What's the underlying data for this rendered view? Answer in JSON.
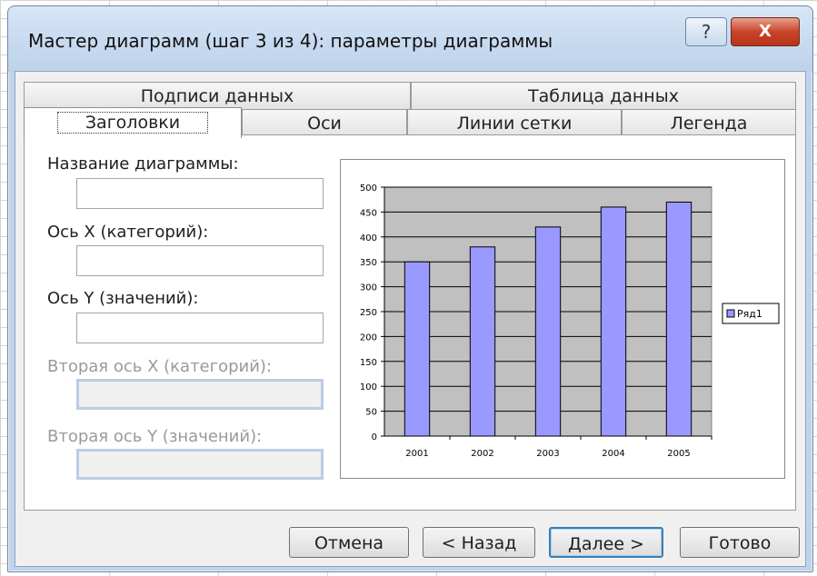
{
  "window": {
    "title": "Мастер диаграмм (шаг 3 из 4): параметры диаграммы",
    "help_label": "?",
    "close_label": "X"
  },
  "tabs": {
    "row1": [
      "Подписи данных",
      "Таблица данных"
    ],
    "row2": [
      "Заголовки",
      "Оси",
      "Линии сетки",
      "Легенда"
    ],
    "active": "Заголовки"
  },
  "fields": {
    "chart_title": {
      "label": "Название диаграммы:",
      "value": ""
    },
    "x_axis": {
      "label": "Ось X (категорий):",
      "value": ""
    },
    "y_axis": {
      "label": "Ось Y (значений):",
      "value": ""
    },
    "x2_axis": {
      "label": "Вторая ось X (категорий):",
      "value": "",
      "disabled": true
    },
    "y2_axis": {
      "label": "Вторая ось Y (значений):",
      "value": "",
      "disabled": true
    }
  },
  "buttons": {
    "cancel": "Отмена",
    "back": "< Назад",
    "next": "Далее >",
    "finish": "Готово"
  },
  "colors": {
    "bar_fill": "#9999ff",
    "plot_area": "#c0c0c0"
  },
  "chart_data": {
    "type": "bar",
    "categories": [
      "2001",
      "2002",
      "2003",
      "2004",
      "2005"
    ],
    "series": [
      {
        "name": "Ряд1",
        "values": [
          350,
          380,
          420,
          460,
          470
        ]
      }
    ],
    "yticks": [
      "0",
      "50",
      "100",
      "150",
      "200",
      "250",
      "300",
      "350",
      "400",
      "450",
      "500"
    ],
    "ylim": [
      0,
      500
    ],
    "grid": true,
    "legend": "right"
  }
}
